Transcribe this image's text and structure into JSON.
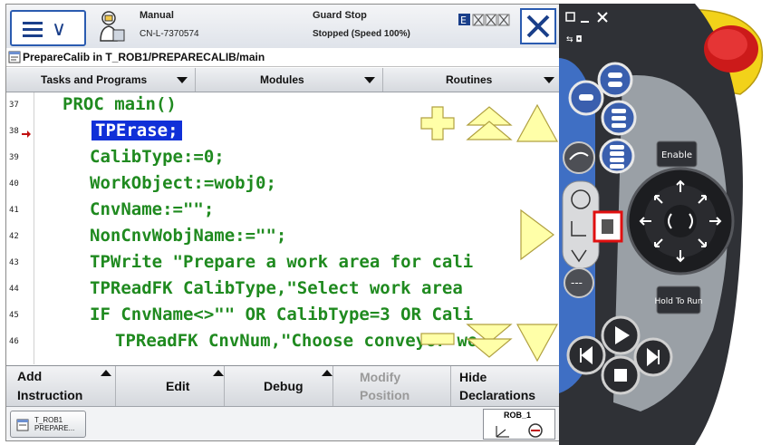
{
  "header": {
    "mode": "Manual",
    "controller_id": "CN-L-7370574",
    "guard": "Guard Stop",
    "state": "Stopped (Speed 100%)"
  },
  "breadcrumb": "PrepareCalib in T_ROB1/PREPARECALIB/main",
  "tabs": {
    "tasks": "Tasks and Programs",
    "modules": "Modules",
    "routines": "Routines"
  },
  "code": {
    "lines": [
      {
        "num": "37",
        "text": "PROC main()"
      },
      {
        "num": "38",
        "text": "TPErase;"
      },
      {
        "num": "39",
        "text": "CalibType:=0;"
      },
      {
        "num": "40",
        "text": "WorkObject:=wobj0;"
      },
      {
        "num": "41",
        "text": "CnvName:=\"\";"
      },
      {
        "num": "42",
        "text": "NonCnvWobjName:=\"\";"
      },
      {
        "num": "43",
        "text": "TPWrite \"Prepare a work area for cali"
      },
      {
        "num": "44",
        "text": "TPReadFK CalibType,\"Select work area"
      },
      {
        "num": "45",
        "text": "IF CnvName<>\"\" OR CalibType=3 OR Cali"
      },
      {
        "num": "46",
        "text": "TPReadFK CnvNum,\"Choose conveyor wo"
      }
    ]
  },
  "bottom_menu": {
    "add_1": "Add",
    "add_2": "Instruction",
    "edit": "Edit",
    "debug": "Debug",
    "modify_1": "Modify",
    "modify_2": "Position",
    "hide_1": "Hide",
    "hide_2": "Declarations"
  },
  "taskbar": {
    "task_1": "T_ROB1",
    "task_2": "PREPARE...",
    "robot": "ROB_1"
  },
  "flexpendant": {
    "enable": "Enable",
    "hold_to_run": "Hold To Run"
  },
  "colors": {
    "code_green": "#1f8a1f",
    "selection": "#1030d8",
    "overlay_yellow": "#ffffa8",
    "panel_blue": "#3f6fc4",
    "e_stop_red": "#cc1a1a",
    "highlight_red": "#e01010"
  }
}
